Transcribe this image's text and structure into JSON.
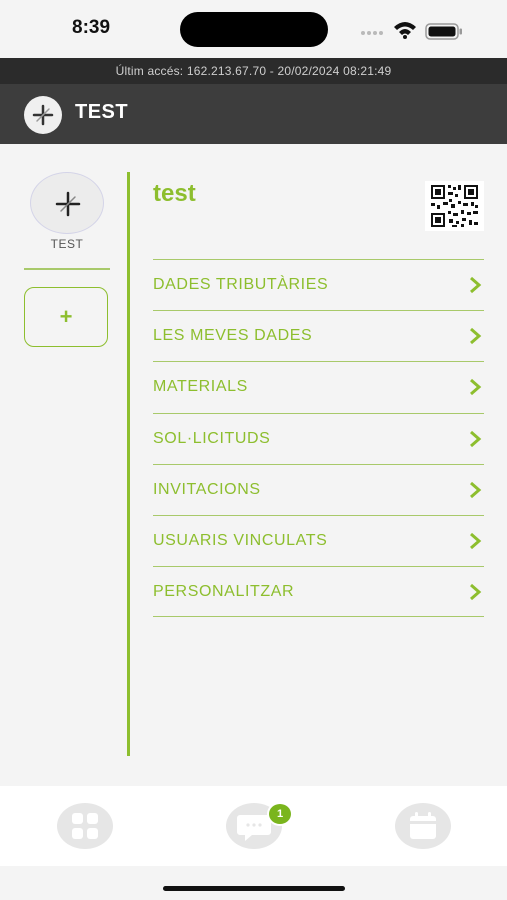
{
  "status_bar": {
    "time": "8:39"
  },
  "last_access": {
    "text": "Últim accés: 162.213.67.70 - 20/02/2024 08:21:49"
  },
  "header": {
    "title": "TEST",
    "logo_icon": "pinwheel-logo-icon"
  },
  "sidebar": {
    "avatar_label": "TEST",
    "add_label": "+"
  },
  "profile": {
    "name": "test",
    "qr_icon": "qr-code-icon"
  },
  "menu": {
    "items": [
      {
        "label": "DADES TRIBUTÀRIES"
      },
      {
        "label": "LES MEVES DADES"
      },
      {
        "label": "MATERIALS"
      },
      {
        "label": "SOL·LICITUDS"
      },
      {
        "label": "INVITACIONS"
      },
      {
        "label": "USUARIS VINCULATS"
      },
      {
        "label": "PERSONALITZAR"
      }
    ]
  },
  "bottom_nav": {
    "items": [
      {
        "icon": "dashboard-grid-icon"
      },
      {
        "icon": "chat-bubble-icon",
        "badge": "1"
      },
      {
        "icon": "calendar-icon"
      }
    ]
  },
  "colors": {
    "accent": "#8dbe2e",
    "header_bg": "#3d3d3d",
    "banner_bg": "#2b2b2b",
    "page_bg": "#f4f4f4"
  }
}
